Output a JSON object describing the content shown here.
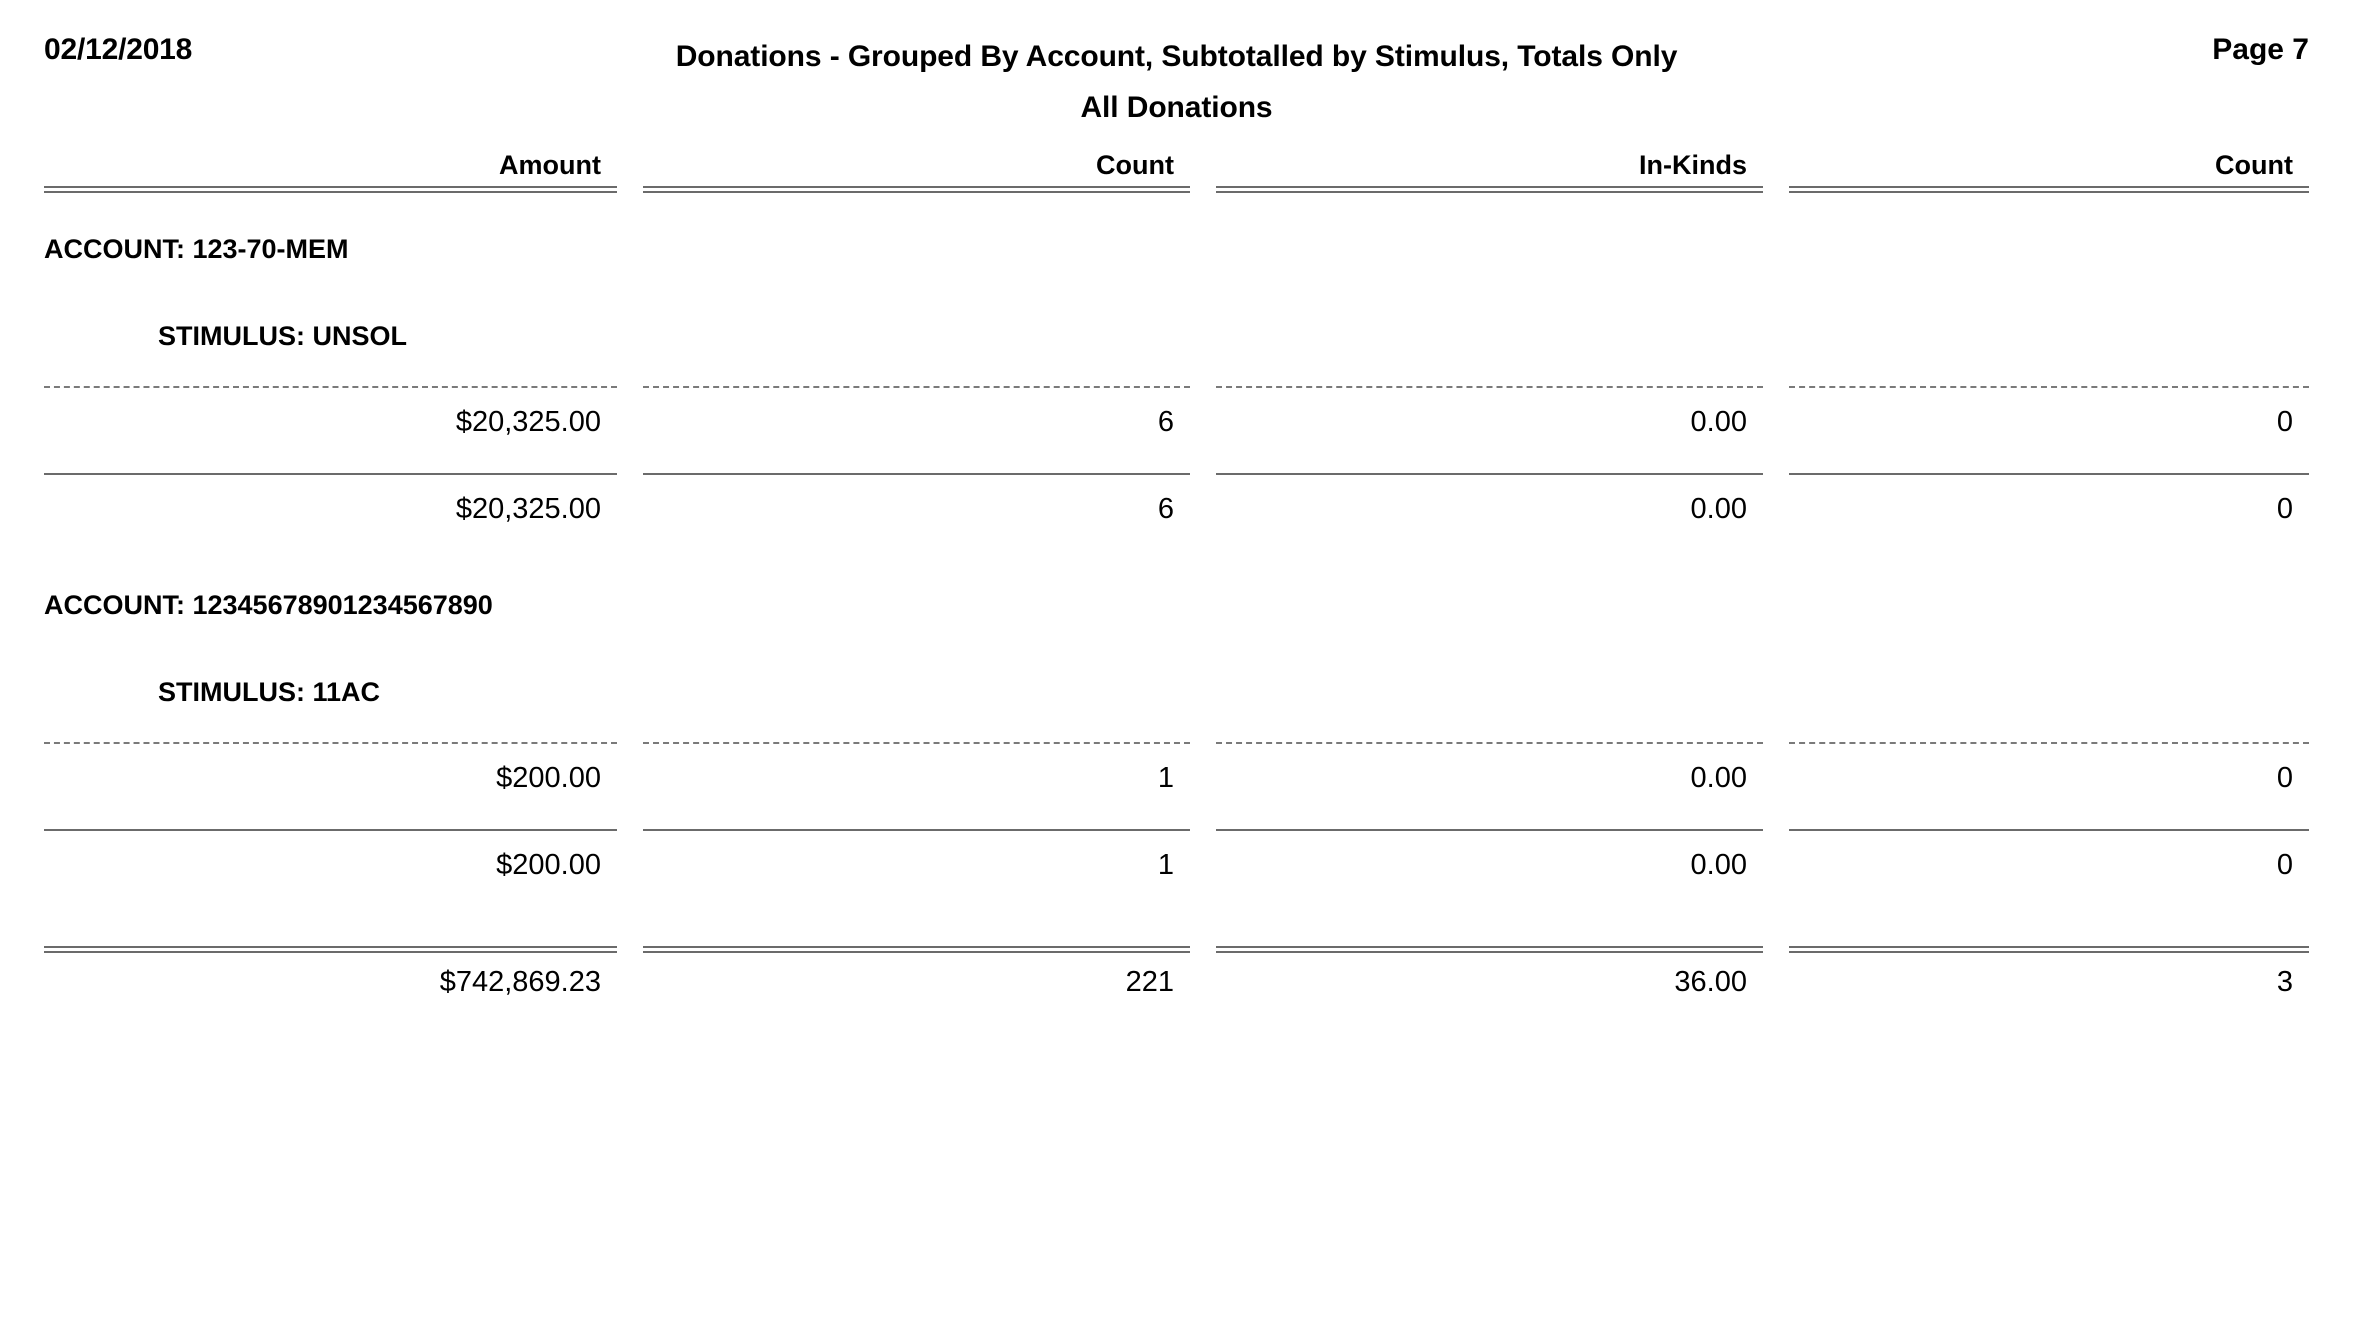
{
  "header": {
    "date": "02/12/2018",
    "title_line1": "Donations - Grouped By Account, Subtotalled by Stimulus, Totals Only",
    "title_line2": "All Donations",
    "page_label": "Page 7"
  },
  "columns": {
    "amount": "Amount",
    "count1": "Count",
    "inkinds": "In-Kinds",
    "count2": "Count"
  },
  "groups": [
    {
      "account_label": "ACCOUNT: 123-70-MEM",
      "stimulus_label": "STIMULUS: UNSOL",
      "detail": {
        "amount": "$20,325.00",
        "count1": "6",
        "inkinds": "0.00",
        "count2": "0"
      },
      "subtotal": {
        "amount": "$20,325.00",
        "count1": "6",
        "inkinds": "0.00",
        "count2": "0"
      }
    },
    {
      "account_label": "ACCOUNT: 12345678901234567890",
      "stimulus_label": "STIMULUS: 11AC",
      "detail": {
        "amount": "$200.00",
        "count1": "1",
        "inkinds": "0.00",
        "count2": "0"
      },
      "subtotal": {
        "amount": "$200.00",
        "count1": "1",
        "inkinds": "0.00",
        "count2": "0"
      }
    }
  ],
  "grand_total": {
    "amount": "$742,869.23",
    "count1": "221",
    "inkinds": "36.00",
    "count2": "3"
  }
}
